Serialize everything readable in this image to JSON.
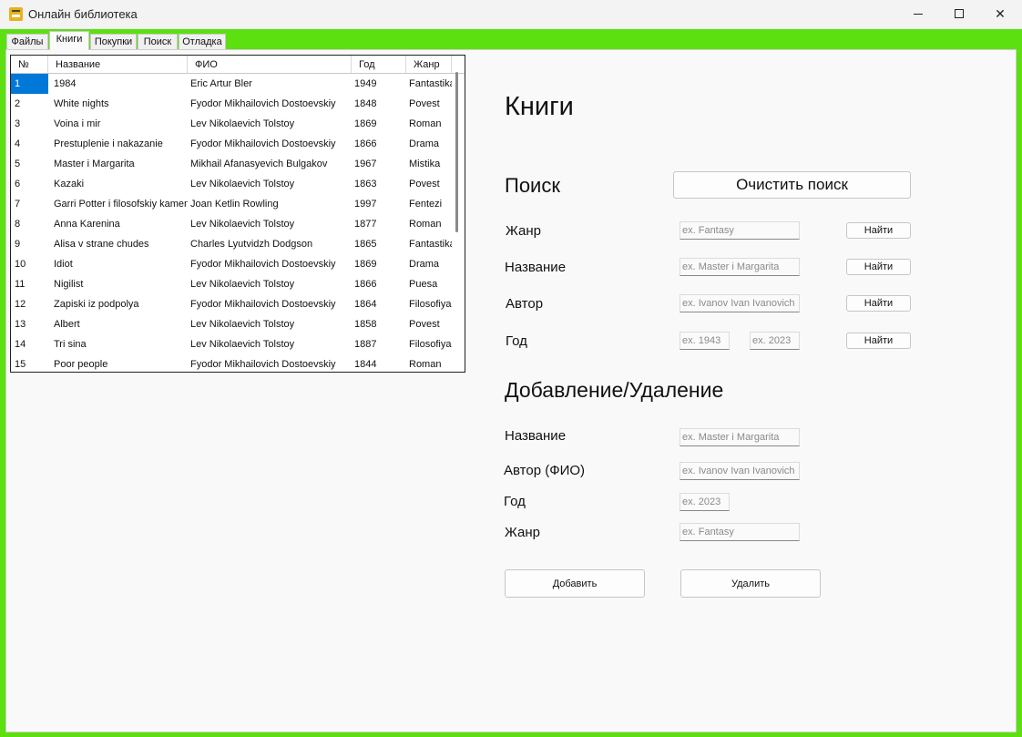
{
  "window": {
    "title": "Онлайн библиотека"
  },
  "tabs": [
    "Файлы",
    "Книги",
    "Покупки",
    "Поиск",
    "Отладка"
  ],
  "grid": {
    "columns": [
      "№",
      "Название",
      "ФИО",
      "Год",
      "Жанр"
    ],
    "rows": [
      [
        "1",
        "1984",
        "Eric Artur Bler",
        "1949",
        "Fantastika"
      ],
      [
        "2",
        "White nights",
        "Fyodor Mikhailovich Dostoevskiy",
        "1848",
        "Povest"
      ],
      [
        "3",
        "Voina i mir",
        "Lev Nikolaevich Tolstoy",
        "1869",
        "Roman"
      ],
      [
        "4",
        "Prestuplenie i nakazanie",
        "Fyodor Mikhailovich Dostoevskiy",
        "1866",
        "Drama"
      ],
      [
        "5",
        "Master i Margarita",
        "Mikhail Afanasyevich Bulgakov",
        "1967",
        "Mistika"
      ],
      [
        "6",
        "Kazaki",
        "Lev Nikolaevich Tolstoy",
        "1863",
        "Povest"
      ],
      [
        "7",
        "Garri Potter i filosofskiy kamen",
        "Joan Ketlin Rowling",
        "1997",
        "Fentezi"
      ],
      [
        "8",
        "Anna Karenina",
        "Lev Nikolaevich Tolstoy",
        "1877",
        "Roman"
      ],
      [
        "9",
        "Alisa v strane chudes",
        "Charles Lyutvidzh Dodgson",
        "1865",
        "Fantastika"
      ],
      [
        "10",
        "Idiot",
        "Fyodor Mikhailovich Dostoevskiy",
        "1869",
        "Drama"
      ],
      [
        "11",
        "Nigilist",
        "Lev Nikolaevich Tolstoy",
        "1866",
        "Puesa"
      ],
      [
        "12",
        "Zapiski iz podpolya",
        "Fyodor Mikhailovich Dostoevskiy",
        "1864",
        "Filosofiya"
      ],
      [
        "13",
        "Albert",
        "Lev Nikolaevich Tolstoy",
        "1858",
        "Povest"
      ],
      [
        "14",
        "Tri sina",
        "Lev Nikolaevich Tolstoy",
        "1887",
        "Filosofiya"
      ],
      [
        "15",
        "Poor people",
        "Fyodor Mikhailovich Dostoevskiy",
        "1844",
        "Roman"
      ]
    ]
  },
  "page": {
    "title": "Книги"
  },
  "search": {
    "title": "Поиск",
    "clear_label": "Очистить поиск",
    "genre_label": "Жанр",
    "genre_placeholder": "ex. Fantasy",
    "name_label": "Название",
    "name_placeholder": "ex. Master i Margarita",
    "author_label": "Автор",
    "author_placeholder": "ex. Ivanov Ivan Ivanovich",
    "year_label": "Год",
    "year_from_placeholder": "ex. 1943",
    "year_to_placeholder": "ex. 2023",
    "find_label": "Найти"
  },
  "edit": {
    "title": "Добавление/Удаление",
    "name_label": "Название",
    "name_placeholder": "ex. Master i Margarita",
    "author_label": "Автор (ФИО)",
    "author_placeholder": "ex. Ivanov Ivan Ivanovich",
    "year_label": "Год",
    "year_placeholder": "ex. 2023",
    "genre_label": "Жанр",
    "genre_placeholder": "ex. Fantasy",
    "add_label": "Добавить",
    "delete_label": "Удалить"
  },
  "colors": {
    "frame": "#5ce010",
    "selection": "#0078d7"
  }
}
